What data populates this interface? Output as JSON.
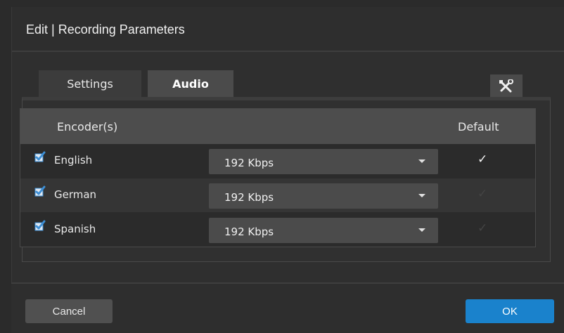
{
  "dialog": {
    "title": "Edit | Recording Parameters"
  },
  "tabs": [
    {
      "label": "Settings",
      "active": false
    },
    {
      "label": "Audio",
      "active": true
    }
  ],
  "tools": {
    "icon": "wrench-screwdriver-icon"
  },
  "table": {
    "headers": {
      "encoders": "Encoder(s)",
      "default": "Default"
    },
    "rows": [
      {
        "language": "English",
        "enabled": true,
        "bitrate": "192 Kbps",
        "is_default": true
      },
      {
        "language": "German",
        "enabled": true,
        "bitrate": "192 Kbps",
        "is_default": false
      },
      {
        "language": "Spanish",
        "enabled": true,
        "bitrate": "192 Kbps",
        "is_default": false
      }
    ]
  },
  "footer": {
    "cancel_label": "Cancel",
    "ok_label": "OK"
  },
  "colors": {
    "accent": "#1a82cc",
    "checkbox": "#3d8fd6"
  },
  "glyphs": {
    "check": "✓"
  }
}
